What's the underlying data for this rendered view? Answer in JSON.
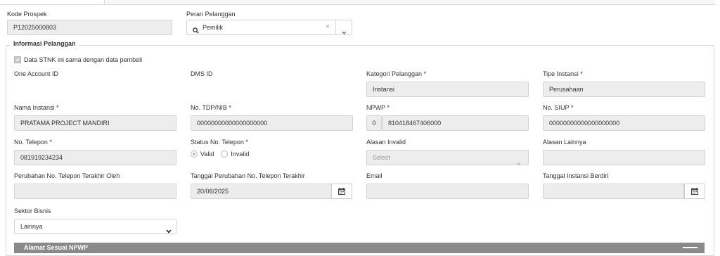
{
  "header": {
    "kode_prospek_label": "Kode Prospek",
    "kode_prospek_value": "P12025000803",
    "peran_label": "Peran Pelanggan",
    "peran_value": "Pemilik",
    "peran_clear": "×"
  },
  "section": {
    "legend": "Informasi Pelanggan",
    "checkbox_label": "Data STNK ini sama dengan data pembeli"
  },
  "fields": {
    "one_account_id_label": "One Account ID",
    "dms_id_label": "DMS ID",
    "kategori_label": "Kategori Pelanggan *",
    "kategori_value": "Instansi",
    "tipe_label": "Tipe Instansi *",
    "tipe_value": "Perusahaan",
    "nama_label": "Nama Instansi *",
    "nama_value": "PRATAMA PROJECT MANDIRI",
    "tdp_label": "No. TDP/NIB *",
    "tdp_value": "00000000000000000000",
    "npwp_label": "NPWP *",
    "npwp_prefix": "0",
    "npwp_value": "810418467406000",
    "siup_label": "No. SIUP *",
    "siup_value": "00000000000000000000",
    "telepon_label": "No. Telepon *",
    "telepon_value": "081919234234",
    "status_label": "Status No. Telepon *",
    "status_valid": "Valid",
    "status_invalid": "Invalid",
    "alasan_invalid_label": "Alasan Invalid",
    "alasan_invalid_placeholder": "Select",
    "alasan_lainnya_label": "Alasan Lainnya",
    "perubahan_oleh_label": "Perubahan No. Telepon Terakhir Oleh",
    "tanggal_perubahan_label": "Tanggal Perubahan No. Telepon Terakhir",
    "tanggal_perubahan_value": "20/08/2025",
    "email_label": "Email",
    "tanggal_berdiri_label": "Tanggal Instansi Berdiri",
    "sektor_label": "Sektor Bisnis",
    "sektor_value": "Lainnya"
  },
  "bottom": {
    "bar_label": "Alamat Sesuai NPWP"
  }
}
